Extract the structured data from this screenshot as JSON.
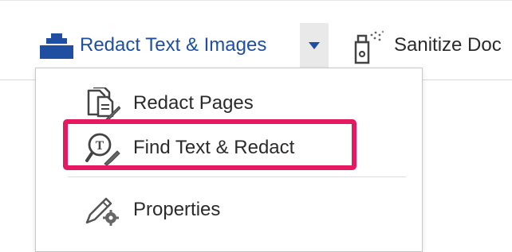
{
  "toolbar": {
    "redact_button": {
      "label": "Redact Text & Images",
      "icon": "redact-marker-icon"
    },
    "dropdown_toggle": {
      "icon": "caret-down-icon"
    },
    "sanitize_button": {
      "label": "Sanitize Doc",
      "icon": "sanitize-spray-icon"
    }
  },
  "menu": {
    "items": [
      {
        "label": "Redact Pages",
        "icon": "redact-pages-icon"
      },
      {
        "label": "Find Text & Redact",
        "icon": "find-text-redact-icon",
        "highlighted": true
      },
      {
        "label": "Properties",
        "icon": "properties-pen-gear-icon"
      }
    ]
  },
  "colors": {
    "accent_blue": "#1f4fa0",
    "highlight": "#e5195f",
    "dropdown_bg": "#e9e9e9"
  }
}
